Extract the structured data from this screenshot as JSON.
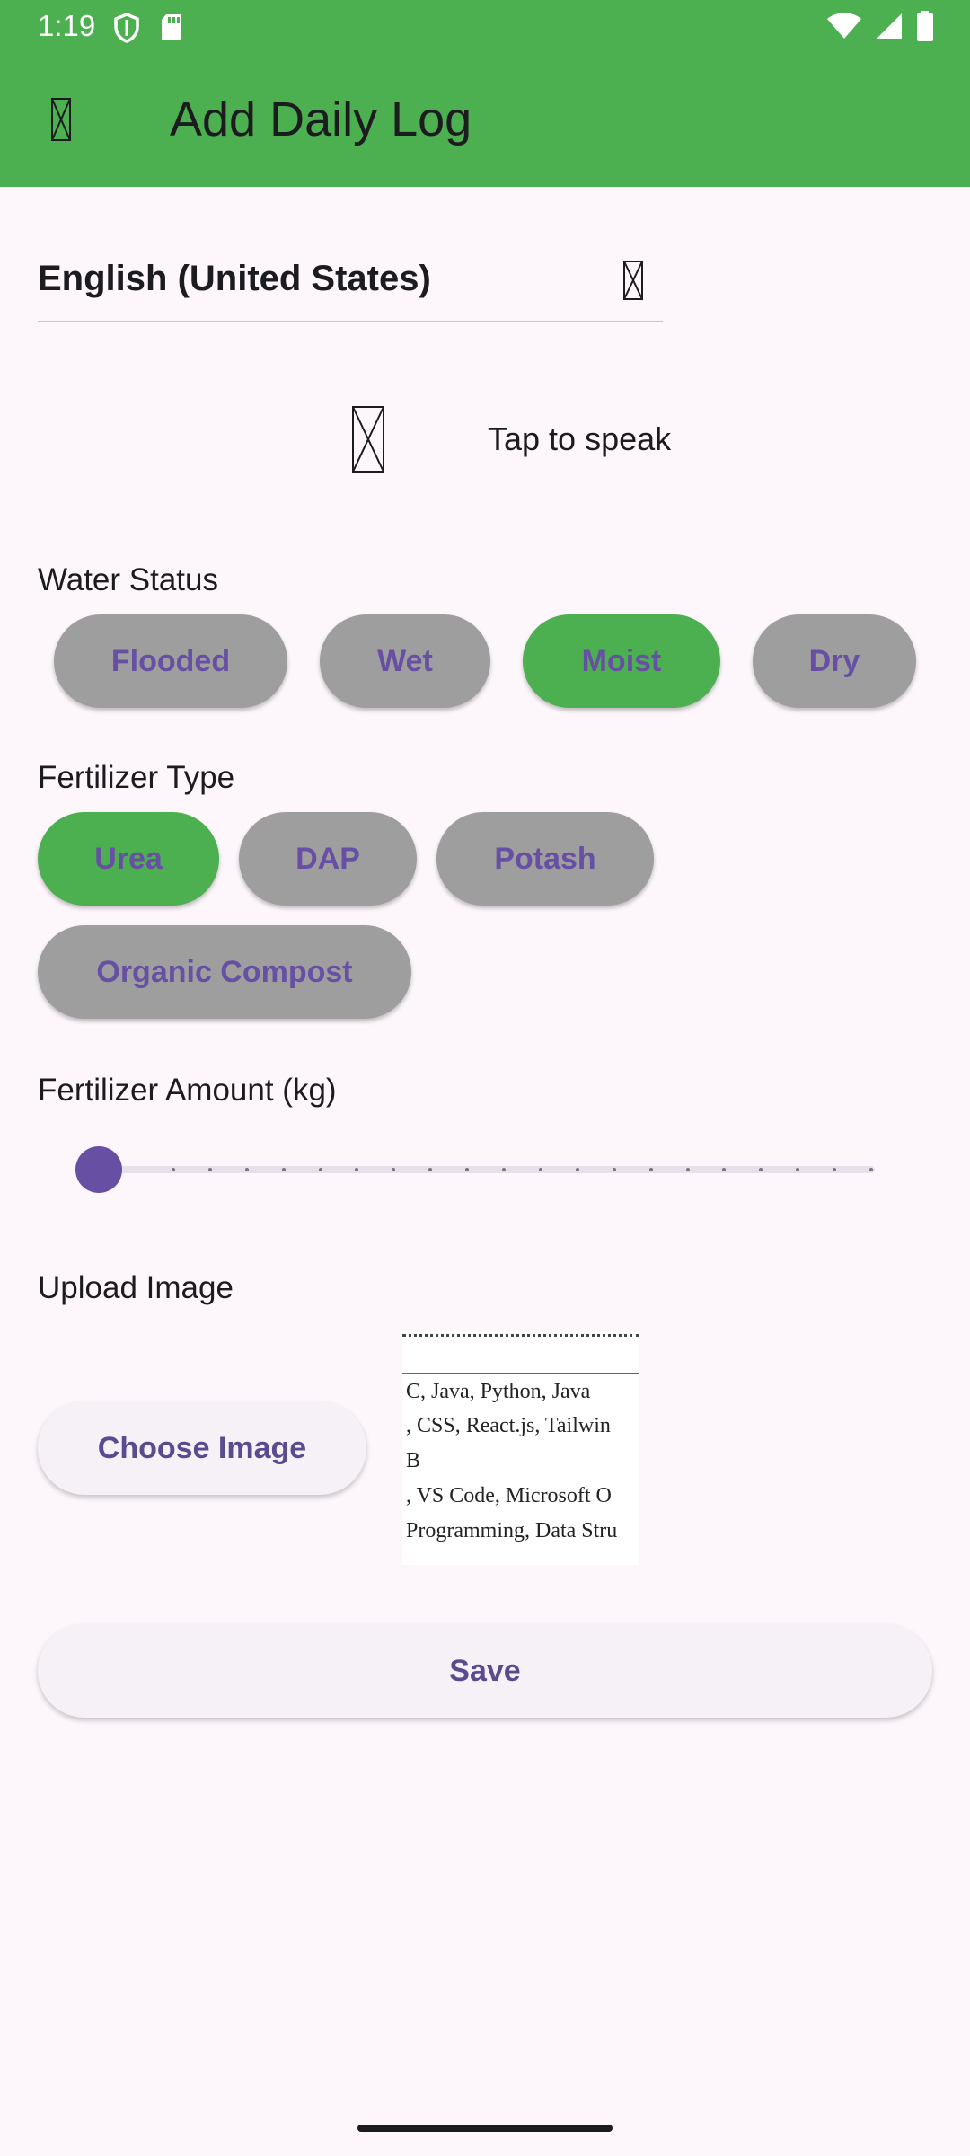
{
  "status_bar": {
    "time": "1:19",
    "icons": [
      "shield-icon",
      "sd-card-icon",
      "wifi-icon",
      "signal-icon",
      "battery-icon"
    ]
  },
  "app_bar": {
    "title": "Add Daily Log",
    "menu_icon": "menu-icon",
    "background": "#4caf50"
  },
  "language": {
    "selected": "English (United States)",
    "dropdown_icon": "dropdown-icon"
  },
  "speech": {
    "label": "Tap to speak",
    "icon": "mic-icon"
  },
  "water_status": {
    "label": "Water Status",
    "options": [
      "Flooded",
      "Wet",
      "Moist",
      "Dry"
    ],
    "selected": "Moist"
  },
  "fertilizer_type": {
    "label": "Fertilizer Type",
    "options": [
      "Urea",
      "DAP",
      "Potash",
      "Organic Compost"
    ],
    "selected": "Urea"
  },
  "fertilizer_amount": {
    "label": "Fertilizer Amount (kg)",
    "value_fraction": 0
  },
  "upload": {
    "label": "Upload Image",
    "button_label": "Choose Image",
    "preview_lines": [
      "C, Java, Python, Java",
      ", CSS, React.js, Tailwin",
      "B",
      ", VS Code, Microsoft O",
      "Programming, Data Stru"
    ]
  },
  "save_label": "Save",
  "colors": {
    "selected_chip": "#4caf50",
    "unselected_chip": "#9e9e9e",
    "accent": "#6750a4"
  }
}
